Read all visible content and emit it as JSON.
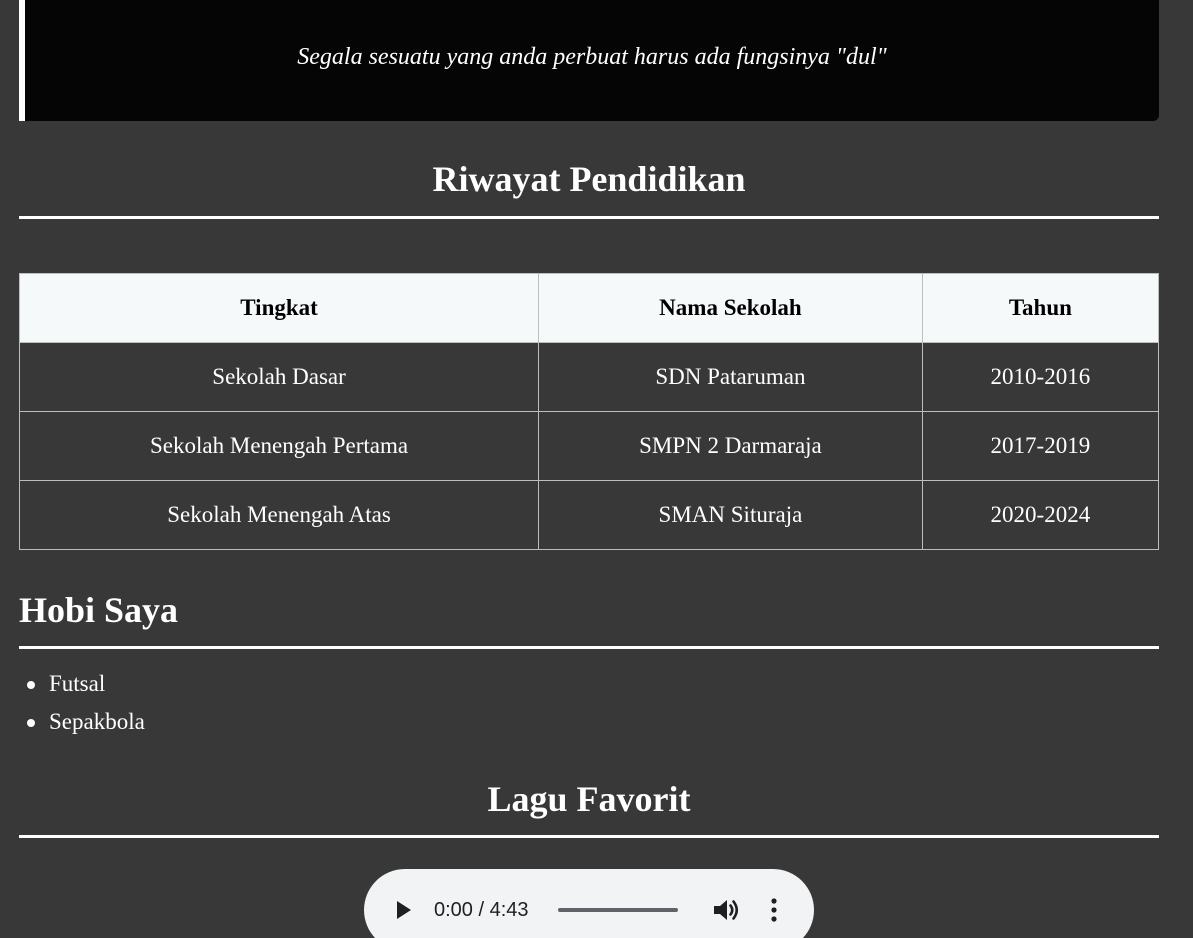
{
  "quote": {
    "text": "Segala sesuatu yang anda perbuat harus ada fungsinya \"dul\""
  },
  "education": {
    "title": "Riwayat Pendidikan",
    "headers": [
      "Tingkat",
      "Nama Sekolah",
      "Tahun"
    ],
    "rows": [
      [
        "Sekolah Dasar",
        "SDN Pataruman",
        "2010-2016"
      ],
      [
        "Sekolah Menengah Pertama",
        "SMPN 2 Darmaraja",
        "2017-2019"
      ],
      [
        "Sekolah Menengah Atas",
        "SMAN Situraja",
        "2020-2024"
      ]
    ]
  },
  "hobbies": {
    "title": "Hobi Saya",
    "items": [
      "Futsal",
      "Sepakbola"
    ]
  },
  "music": {
    "title": "Lagu Favorit",
    "player": {
      "time_display": "0:00 / 4:43",
      "progress": 0,
      "icons": [
        "play-icon",
        "volume-icon",
        "more-vert-icon"
      ]
    }
  },
  "colors": {
    "background": "#383838",
    "quote_box": "#050505",
    "table_header": "#f5f9fa",
    "player": "#f1f3f4"
  }
}
